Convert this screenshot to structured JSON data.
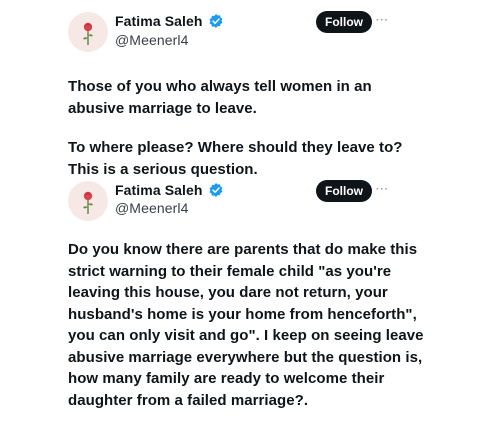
{
  "tweets": [
    {
      "display_name": "Fatima Saleh",
      "handle": "@Meenerl4",
      "follow_label": "Follow",
      "more_label": "···",
      "paragraphs": [
        "Those of you who always tell women in an abusive marriage to leave.",
        "To where please? Where should they leave to? This is a serious question."
      ]
    },
    {
      "display_name": "Fatima Saleh",
      "handle": "@Meenerl4",
      "follow_label": "Follow",
      "more_label": "···",
      "paragraphs": [
        "Do you know there are parents that do make this strict warning to their female child \"as you're leaving this house, you dare not return, your husband's home is your home from henceforth\", you can only visit and go\". I keep on seeing leave abusive marriage everywhere but the question is, how many family are ready to welcome their daughter from a failed marriage?."
      ]
    }
  ],
  "icons": {
    "avatar": "rose-flower-icon",
    "verified": "verified-badge-icon",
    "more": "more-options-icon"
  },
  "colors": {
    "follow_button": "#0f1419",
    "verified_badge": "#1d9bf0",
    "avatar_background": "#f6e8e5",
    "rose": "#d9434f"
  }
}
